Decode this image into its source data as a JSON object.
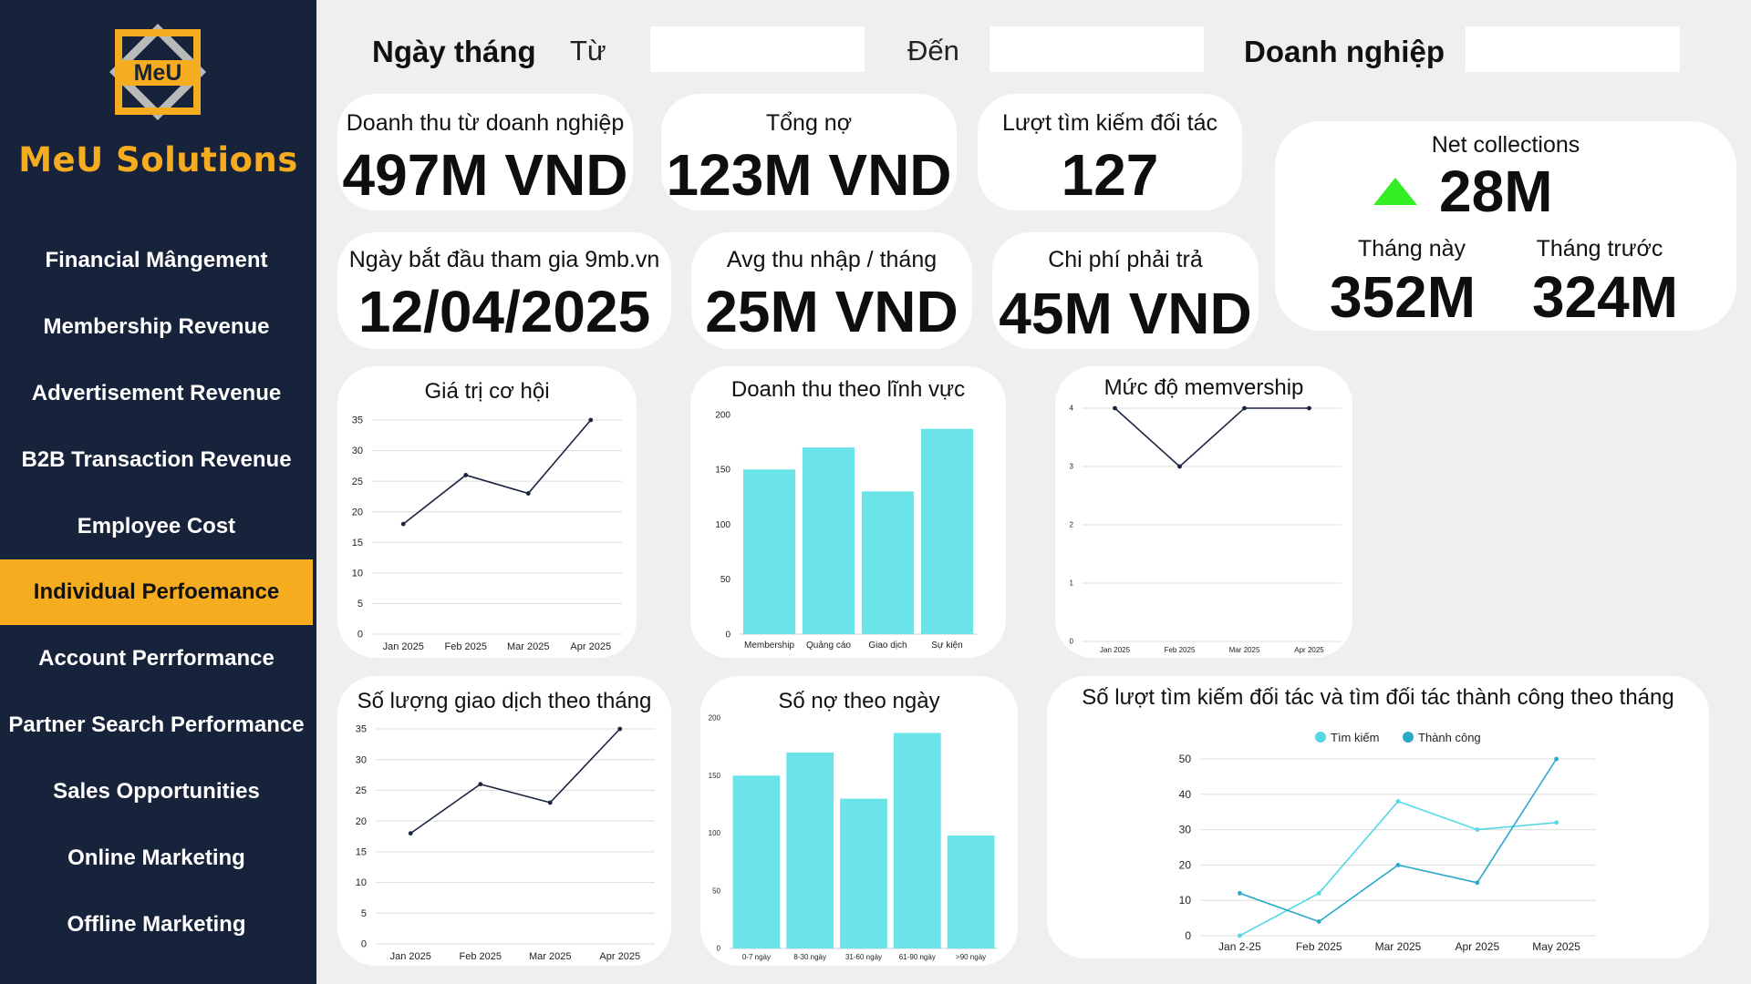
{
  "brand": {
    "logo_text": "MeU",
    "name": "MeU Solutions"
  },
  "colors": {
    "sidebar": "#17223b",
    "accent": "#f5ac1f",
    "bar": "#6ae4e9",
    "line": "#1b2540",
    "line_alt": "#2aa9c9",
    "up_arrow": "#33ee22"
  },
  "nav": [
    {
      "label": "Financial Mângement",
      "active": false
    },
    {
      "label": "Membership Revenue",
      "active": false
    },
    {
      "label": "Advertisement Revenue",
      "active": false
    },
    {
      "label": "B2B Transaction Revenue",
      "active": false
    },
    {
      "label": "Employee Cost",
      "active": false
    },
    {
      "label": "Individual Perfoemance",
      "active": true
    },
    {
      "label": "Account Perrformance",
      "active": false
    },
    {
      "label": "Partner Search Performance",
      "active": false
    },
    {
      "label": "Sales Opportunities",
      "active": false
    },
    {
      "label": "Online Marketing",
      "active": false
    },
    {
      "label": "Offline Marketing",
      "active": false
    }
  ],
  "filters": {
    "date_label": "Ngày tháng",
    "from_label": "Từ",
    "from_value": "",
    "to_label": "Đến",
    "to_value": "",
    "business_label": "Doanh nghiệp",
    "business_value": ""
  },
  "kpis": {
    "revenue": {
      "label": "Doanh thu từ doanh nghiệp",
      "value": "497M VND"
    },
    "debt": {
      "label": "Tổng nợ",
      "value": "123M VND"
    },
    "searches": {
      "label": "Lượt tìm kiếm đối tác",
      "value": "127"
    },
    "join_date": {
      "label": "Ngày bắt đầu tham gia 9mb.vn",
      "value": "12/04/2025"
    },
    "avg_income": {
      "label": "Avg thu nhập / tháng",
      "value": "25M VND"
    },
    "payable": {
      "label": "Chi phí phải trả",
      "value": "45M VND"
    }
  },
  "net": {
    "label": "Net collections",
    "value": "28M",
    "trend_icon": "triangle-up-icon",
    "this_month_label": "Tháng này",
    "this_month_value": "352M",
    "last_month_label": "Tháng trước",
    "last_month_value": "324M"
  },
  "chart_data": [
    {
      "id": "opportunity",
      "type": "line",
      "title": "Giá trị cơ hội",
      "categories": [
        "Jan 2025",
        "Feb 2025",
        "Mar 2025",
        "Apr 2025"
      ],
      "series": [
        {
          "values": [
            18,
            26,
            23,
            35
          ]
        }
      ],
      "ylim": [
        0,
        35
      ],
      "yticks": [
        0,
        5,
        10,
        15,
        20,
        25,
        30,
        35
      ],
      "grid": true
    },
    {
      "id": "revenue_by_field",
      "type": "bar",
      "title": "Doanh thu theo lĩnh vực",
      "categories": [
        "Membership",
        "Quảng cáo",
        "Giao dịch",
        "Sự kiện"
      ],
      "values": [
        150,
        170,
        130,
        187
      ],
      "ylim": [
        0,
        200
      ],
      "yticks": [
        0,
        50,
        100,
        150,
        200
      ],
      "grid": false
    },
    {
      "id": "membership_level",
      "type": "line",
      "title": "Mức độ memvership",
      "categories": [
        "Jan 2025",
        "Feb 2025",
        "Mar 2025",
        "Apr 2025"
      ],
      "series": [
        {
          "values": [
            4,
            3,
            4,
            4
          ]
        }
      ],
      "ylim": [
        0,
        4
      ],
      "yticks": [
        0,
        1,
        2,
        3,
        4
      ],
      "grid": true
    },
    {
      "id": "transactions",
      "type": "line",
      "title": "Số lượng giao dịch theo tháng",
      "categories": [
        "Jan 2025",
        "Feb 2025",
        "Mar 2025",
        "Apr 2025"
      ],
      "series": [
        {
          "values": [
            18,
            26,
            23,
            35
          ]
        }
      ],
      "ylim": [
        0,
        35
      ],
      "yticks": [
        0,
        5,
        10,
        15,
        20,
        25,
        30,
        35
      ],
      "grid": true
    },
    {
      "id": "debt_by_days",
      "type": "bar",
      "title": "Số nợ theo ngày",
      "categories": [
        "0-7 ngày",
        "8-30 ngày",
        "31-60 ngày",
        "61-90 ngày",
        ">90 ngày"
      ],
      "values": [
        150,
        170,
        130,
        187,
        98
      ],
      "ylim": [
        0,
        200
      ],
      "yticks": [
        0,
        50,
        100,
        150,
        200
      ],
      "grid": false
    },
    {
      "id": "partner_search",
      "type": "line",
      "title": "Số lượt tìm kiếm đối tác và tìm đối tác thành công theo tháng",
      "categories": [
        "Jan 2-25",
        "Feb 2025",
        "Mar 2025",
        "Apr 2025",
        "May 2025"
      ],
      "series": [
        {
          "name": "Tìm kiếm",
          "values": [
            0,
            12,
            38,
            30,
            32
          ],
          "color": "#55d8e6"
        },
        {
          "name": "Thành công",
          "values": [
            12,
            4,
            20,
            15,
            50
          ],
          "color": "#2aa9c9"
        }
      ],
      "ylim": [
        0,
        50
      ],
      "yticks": [
        0,
        10,
        20,
        30,
        40,
        50
      ],
      "legend": "top-center",
      "grid": true
    }
  ]
}
